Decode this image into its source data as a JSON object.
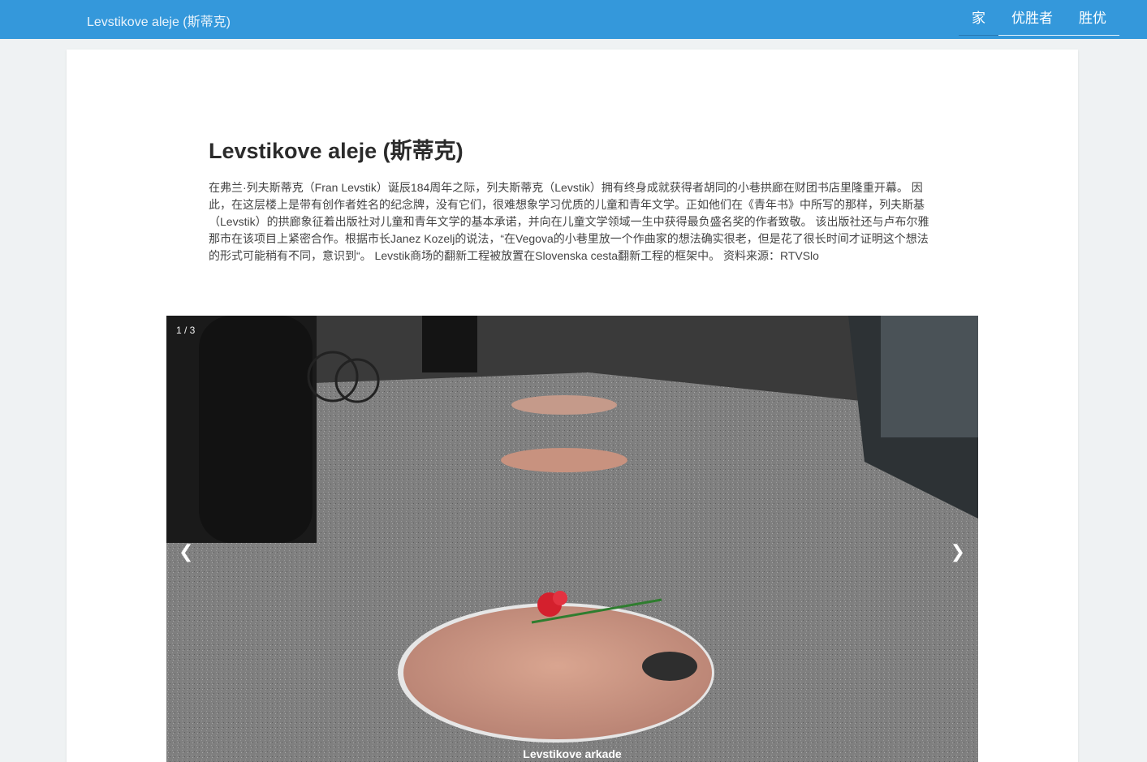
{
  "header": {
    "brand": "Levstikove aleje (斯蒂克)",
    "nav": [
      {
        "label": "家"
      },
      {
        "label": "优胜者"
      },
      {
        "label": "胜优"
      }
    ]
  },
  "article": {
    "title": "Levstikove aleje (斯蒂克)",
    "description": "在弗兰·列夫斯蒂克（Fran Levstik）诞辰184周年之际，列夫斯蒂克（Levstik）拥有终身成就获得者胡同的小巷拱廊在财团书店里隆重开幕。 因此，在这层楼上是带有创作者姓名的纪念牌，没有它们，很难想象学习优质的儿童和青年文学。正如他们在《青年书》中所写的那样，列夫斯基（Levstik）的拱廊象征着出版社对儿童和青年文学的基本承诺，并向在儿童文学领域一生中获得最负盛名奖的作者致敬。 该出版社还与卢布尔雅那市在该项目上紧密合作。根据市长Janez Kozelj的说法，“在Vegova的小巷里放一个作曲家的想法确实很老，但是花了很长时间才证明这个想法的形式可能稍有不同，意识到“。 Levstik商场的翻新工程被放置在Slovenska cesta翻新工程的框架中。 资料来源：RTVSlo"
  },
  "slider": {
    "counter": "1 / 3",
    "prev_icon": "❮",
    "next_icon": "❯",
    "caption": "Levstikove arkade"
  },
  "colors": {
    "header_bg": "#3498db",
    "page_bg": "#eff2f3"
  }
}
